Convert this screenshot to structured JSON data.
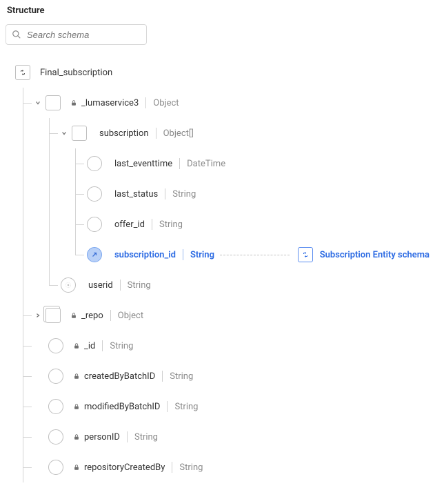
{
  "section_title": "Structure",
  "search": {
    "placeholder": "Search schema"
  },
  "root": {
    "name": "Final_subscription"
  },
  "lumaservice": {
    "name": "_lumaservice3",
    "type": "Object"
  },
  "subscription": {
    "name": "subscription",
    "type": "Object[]"
  },
  "sub_fields": {
    "last_eventtime": {
      "name": "last_eventtime",
      "type": "DateTime"
    },
    "last_status": {
      "name": "last_status",
      "type": "String"
    },
    "offer_id": {
      "name": "offer_id",
      "type": "String"
    },
    "subscription_id": {
      "name": "subscription_id",
      "type": "String"
    }
  },
  "userid": {
    "name": "userid",
    "type": "String"
  },
  "repo": {
    "name": "_repo",
    "type": "Object"
  },
  "root_fields": {
    "id": {
      "name": "_id",
      "type": "String"
    },
    "createdByBatchID": {
      "name": "createdByBatchID",
      "type": "String"
    },
    "modifiedByBatchID": {
      "name": "modifiedByBatchID",
      "type": "String"
    },
    "personID": {
      "name": "personID",
      "type": "String"
    },
    "repositoryCreatedBy": {
      "name": "repositoryCreatedBy",
      "type": "String"
    }
  },
  "relationship": {
    "label": "Subscription Entity schema"
  }
}
